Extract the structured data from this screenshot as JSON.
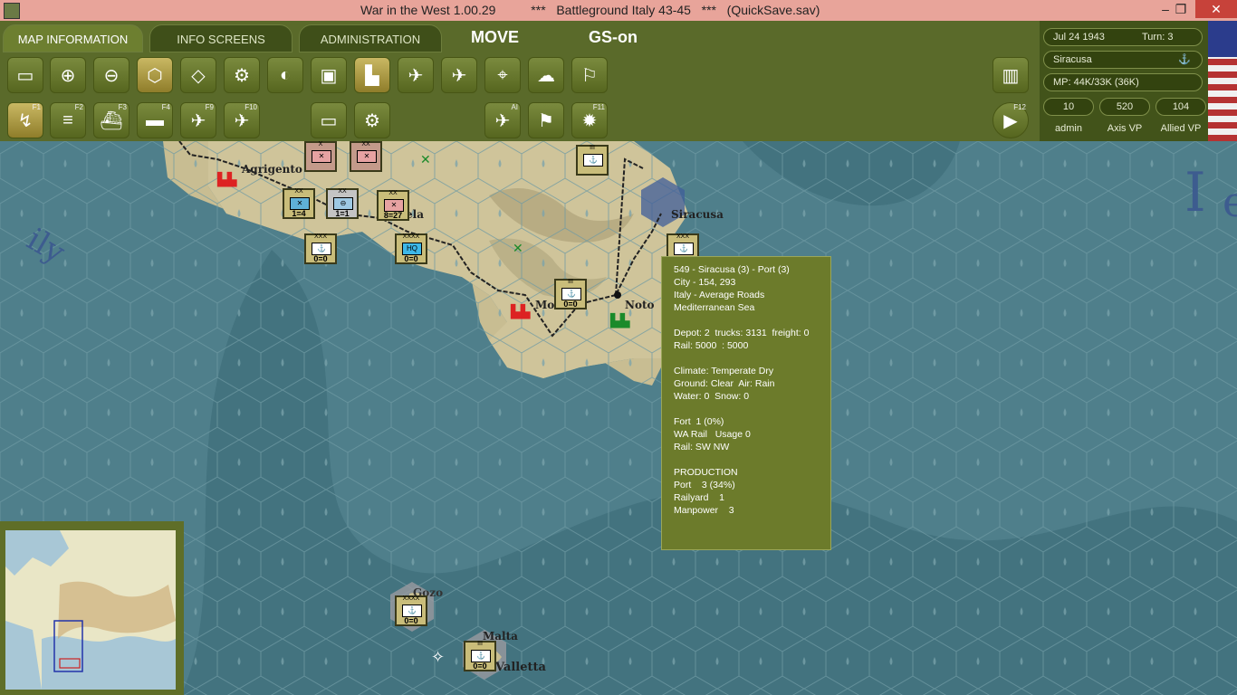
{
  "window": {
    "title": "War in the West 1.00.29          ***   Battleground Italy 43-45   ***   (QuickSave.sav)",
    "min": "–",
    "max": "❐",
    "close": "✕"
  },
  "tabs": [
    {
      "label": "MAP INFORMATION"
    },
    {
      "label": "INFO SCREENS"
    },
    {
      "label": "ADMINISTRATION"
    }
  ],
  "modes": {
    "move": "MOVE",
    "gs": "GS-on"
  },
  "toolbar_row1": [
    "layers-icon",
    "zoom-in-icon",
    "zoom-out-icon",
    "hex-grid-icon",
    "terrain-icon",
    "gear-icon",
    "unit-counter-icon",
    "supply-icon",
    "industry-icon",
    "air-strength-icon",
    "air-mission-icon",
    "air-target-icon",
    "weather-icon",
    "flag-icon"
  ],
  "toolbar_row2": [
    {
      "icon": "path-icon",
      "key": "F1"
    },
    {
      "icon": "rail-icon",
      "key": "F2"
    },
    {
      "icon": "naval-icon",
      "key": "F3"
    },
    {
      "icon": "ship-icon",
      "key": "F4"
    },
    {
      "icon": "airborne-icon",
      "key": "F9"
    },
    {
      "icon": "air-icon",
      "key": "F10"
    },
    {
      "icon": "frame-icon",
      "key": ""
    },
    {
      "icon": "frame-gear-icon",
      "key": ""
    },
    {
      "icon": "ai-air-icon",
      "key": "AI"
    },
    {
      "icon": "flag-move-icon",
      "key": ""
    },
    {
      "icon": "explosion-icon",
      "key": "F11"
    }
  ],
  "end_turn": {
    "key": "F12"
  },
  "status": {
    "date": "Jul 24 1943",
    "turn": "Turn: 3",
    "location": "Siracusa",
    "mp": "MP:  44K/33K (36K)",
    "admin_value": "10",
    "admin_label": "admin",
    "axis_vp": "520",
    "axis_vp_label": "Axis VP",
    "allied_vp": "104",
    "allied_vp_label": "Allied VP"
  },
  "map_labels": {
    "agrigento": "Agrigento",
    "gela": "ela",
    "siracusa": "Siracusa",
    "noto": "Noto",
    "mo": "Mo",
    "gozo": "Gozo",
    "malta": "Malta",
    "valletta": "Valletta",
    "sicily_part": "ily",
    "ionian_part": "I",
    "ionian_part2": "e"
  },
  "units": {
    "u1_str": "1=4",
    "u2_str": "1=1",
    "u3_str": "8=27",
    "u4_str": "0=0",
    "u5_str": "0=0",
    "u6_str": "0=0",
    "u7_str": "0=0",
    "u8_str": "0=0",
    "hq": "HQ",
    "lvl_x": "X",
    "lvl_xx": "XX",
    "lvl_xxx": "XXX",
    "lvl_xxxx": "XXXX",
    "lvl_iii": "III"
  },
  "hex_info": {
    "line1": "549 - Siracusa (3) - Port (3)",
    "line2": "City - 154, 293",
    "line3": "Italy - Average Roads",
    "line4": "Mediterranean Sea",
    "line5": "Depot: 2  trucks: 3131  freight: 0",
    "line6": "Rail: 5000  : 5000",
    "line7": "Climate: Temperate Dry",
    "line8": "Ground: Clear  Air: Rain",
    "line9": "Water: 0  Snow: 0",
    "line10": "Fort  1 (0%)",
    "line11": "WA Rail   Usage 0",
    "line12": "Rail: SW NW",
    "line13": "PRODUCTION",
    "line14": "Port    3 (34%)",
    "line15": "Railyard    1",
    "line16": "Manpower    3"
  },
  "colors": {
    "toolbar": "#5a6a2a",
    "sea": "#4f7f8b",
    "land": "#c8bd92",
    "tooltip": "#6c7b2b",
    "titlebar": "#e8a49a"
  }
}
